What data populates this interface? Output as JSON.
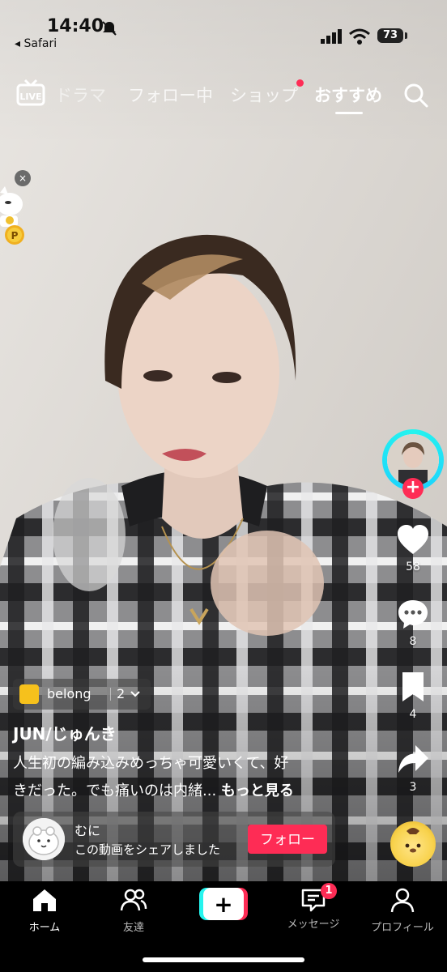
{
  "status_bar": {
    "time": "14:40",
    "back_app": "◂ Safari",
    "battery": "73"
  },
  "top_nav": {
    "live": "LIVE",
    "tabs": [
      {
        "label": "ドラマ"
      },
      {
        "label": "フォロー中"
      },
      {
        "label": "ショップ"
      },
      {
        "label": "おすすめ"
      }
    ],
    "active_tab": "おすすめ"
  },
  "coin_widget": {
    "close": "×",
    "coin_label": "P"
  },
  "right_rail": {
    "likes": "58",
    "comments": "8",
    "bookmarks": "4",
    "shares": "3"
  },
  "video_info": {
    "playlist_name": "belong",
    "playlist_count": "2",
    "username": "JUN/じゅんき",
    "caption_line1": "人生初の編み込みめっちゃ可愛いくて、好",
    "caption_line2": "きだった。でも痛いのは内緒...",
    "more": "もっと見る"
  },
  "share_card": {
    "name": "むに",
    "text": "この動画をシェアしました",
    "follow_button": "フォロー"
  },
  "tab_bar": {
    "home": "ホーム",
    "friends": "友達",
    "create": "+",
    "messages": "メッセージ",
    "messages_badge": "1",
    "profile": "プロフィール"
  },
  "colors": {
    "accent": "#fe2c55",
    "cyan": "#25f4ee",
    "tabbar_bg": "#000000"
  }
}
